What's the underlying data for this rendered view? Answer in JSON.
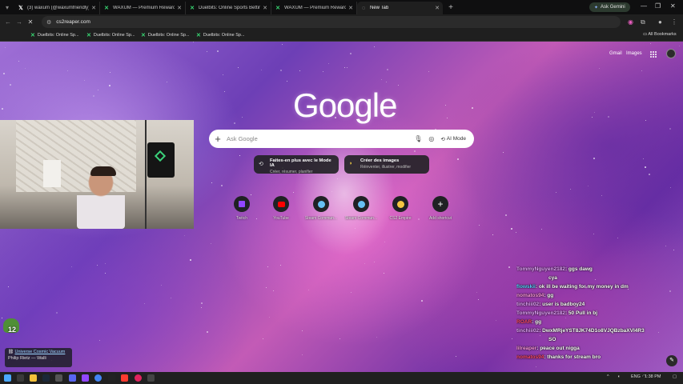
{
  "browser": {
    "tabs": [
      {
        "label": "(3) waxum (@waxumfriendly) /",
        "favicon": "x-logo"
      },
      {
        "label": "WAXUM — Premium Rewards",
        "favicon": "duelbits-icon"
      },
      {
        "label": "Duelbits: Online Sports Betting",
        "favicon": "duelbits-icon"
      },
      {
        "label": "WAXUM — Premium Rewards",
        "favicon": "duelbits-icon"
      },
      {
        "label": "New Tab",
        "favicon": "chrome-icon",
        "active": true
      }
    ],
    "new_tab": "+",
    "gemini_label": "Ask Gemini",
    "url": "cs2reaper.com",
    "bookmarks": [
      "Duelbits: Online Sp...",
      "Duelbits: Online Sp...",
      "Duelbits: Online Sp...",
      "Duelbits: Online Sp..."
    ],
    "all_bookmarks": "All Bookmarks"
  },
  "newtab": {
    "gmail": "Gmail",
    "images": "Images",
    "logo": "Google",
    "search_placeholder": "Ask Google",
    "ai_mode": "AI Mode",
    "chips": [
      {
        "title": "Faites-en plus avec le Mode IA",
        "sub": "Créer, résumer, planifier"
      },
      {
        "title": "Créer des images",
        "sub": "Réinventer, illustrer, modifier"
      }
    ],
    "shortcuts": [
      {
        "label": "Twitch",
        "icon": "twitch-icon",
        "color": "#9146ff"
      },
      {
        "label": "YouTube",
        "icon": "youtube-icon",
        "color": "#ff0000"
      },
      {
        "label": "Steam Commun...",
        "icon": "steam-icon",
        "color": "#1b2838"
      },
      {
        "label": "Steam Commun...",
        "icon": "steam-icon",
        "color": "#1b2838"
      },
      {
        "label": "CS2 Empire",
        "icon": "coin-icon",
        "color": "#f5c542"
      },
      {
        "label": "Add shortcut",
        "icon": "plus-icon",
        "color": "#202124"
      }
    ]
  },
  "overlay": {
    "chat": [
      {
        "user": "TommyNguyen2182",
        "msg": ": ggs dawg",
        "cls": "u1"
      },
      {
        "user": "",
        "msg": "cya",
        "cls": "u1"
      },
      {
        "user": "flowskii",
        "msg": ": ok ill be waiting for my money in dm",
        "cls": "u2"
      },
      {
        "user": "nomatos94",
        "msg": ": gg",
        "cls": "u4"
      },
      {
        "user": "tinchiii02",
        "msg": ": user is badboy24",
        "cls": "u1"
      },
      {
        "user": "TommyNguyen2182",
        "msg": ": 50 Pull in bj",
        "cls": "u1"
      },
      {
        "user": "ROAR",
        "msg": ": gg",
        "cls": "u3"
      },
      {
        "user": "",
        "msg": "",
        "cls": "u1"
      },
      {
        "user": "tinchiii02",
        "msg": ": DwxMRjeYST8JK74D1o8VJQBzbaXVI4R3",
        "cls": "u1"
      },
      {
        "user": "",
        "msg": "SO",
        "cls": "u1"
      },
      {
        "user": "lilreaper",
        "msg": ": peace out nigga",
        "cls": "u4"
      },
      {
        "user": "nomatos94",
        "msg": ": thanks for stream bro",
        "cls": "u3"
      }
    ],
    "music_title": "Universe Cosmic Vacuum",
    "music_artist": "Philip Rietz — Walli",
    "frog_count": "12"
  },
  "taskbar": {
    "lang": "ENG",
    "time": "1:38 PM"
  }
}
